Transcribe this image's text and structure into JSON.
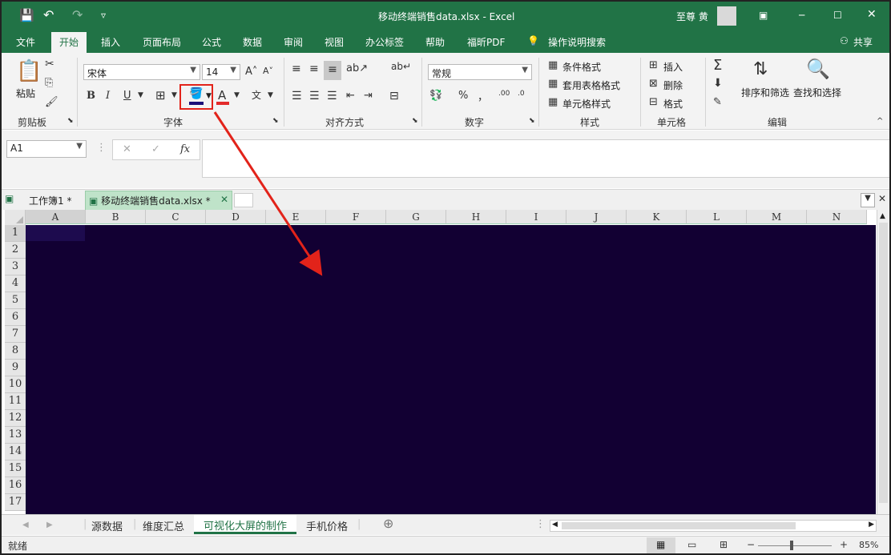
{
  "window": {
    "title": "移动终端销售data.xlsx  -  Excel",
    "user": "至尊 黄",
    "qat": {
      "save": "💾",
      "undo": "↶",
      "redo": "↷",
      "customize": "▿"
    }
  },
  "menu": {
    "items": [
      "文件",
      "开始",
      "插入",
      "页面布局",
      "公式",
      "数据",
      "审阅",
      "视图",
      "办公标签",
      "帮助",
      "福昕PDF",
      "操作说明搜索"
    ],
    "share": "共享"
  },
  "ribbon": {
    "clipboard": {
      "paste": "粘贴",
      "group": "剪贴板"
    },
    "font": {
      "name": "宋体",
      "size": "14",
      "bold": "B",
      "italic": "I",
      "underline": "U",
      "group": "字体",
      "fill_color": "#1a0f78",
      "font_color": "#e32b2b"
    },
    "align": {
      "group": "对齐方式"
    },
    "number": {
      "format": "常规",
      "percent": "%",
      "comma": "，",
      "inc": ".00",
      "dec": ".0",
      "group": "数字"
    },
    "styles": {
      "cond": "条件格式",
      "table": "套用表格格式",
      "cell": "单元格样式",
      "group": "样式"
    },
    "cells": {
      "insert": "插入",
      "delete": "删除",
      "format": "格式",
      "group": "单元格"
    },
    "editing": {
      "sort": "排序和筛选",
      "find": "查找和选择",
      "group": "编辑"
    }
  },
  "formula_bar": {
    "name_box": "A1",
    "fx": "fx",
    "value": ""
  },
  "doc_tabs": [
    {
      "label": "工作簿1 *"
    },
    {
      "label": "移动终端销售data.xlsx *"
    }
  ],
  "columns": [
    "A",
    "B",
    "C",
    "D",
    "E",
    "F",
    "G",
    "H",
    "I",
    "J",
    "K",
    "L",
    "M",
    "N"
  ],
  "rows": [
    "1",
    "2",
    "3",
    "4",
    "5",
    "6",
    "7",
    "8",
    "9",
    "10",
    "11",
    "12",
    "13",
    "14",
    "15",
    "16",
    "17"
  ],
  "sheet_tabs": [
    "源数据",
    "维度汇总",
    "可视化大屏的制作",
    "手机价格"
  ],
  "active_sheet": "可视化大屏的制作",
  "status": {
    "ready": "就绪",
    "zoom": "85%"
  },
  "colors": {
    "excel_green": "#217346",
    "cell_fill": "#120033",
    "highlight": "#e2231a"
  }
}
